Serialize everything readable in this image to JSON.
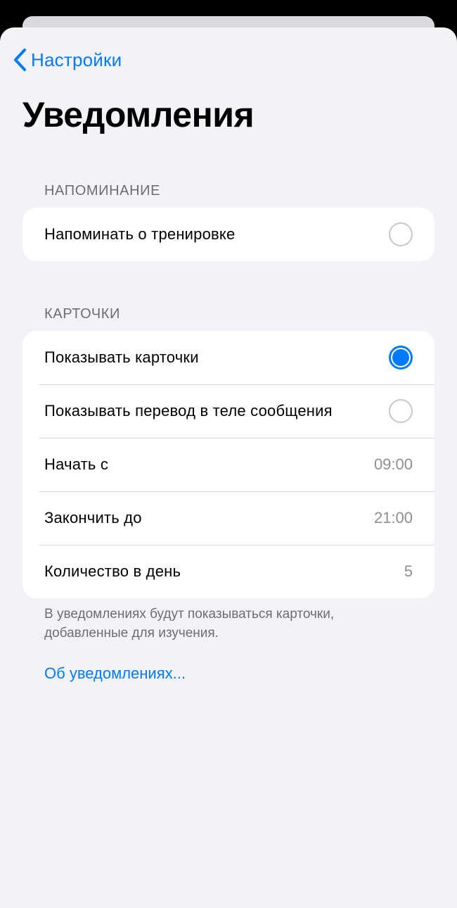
{
  "nav": {
    "back_label": "Настройки",
    "title": "Уведомления"
  },
  "sections": {
    "reminder": {
      "header": "НАПОМИНАНИЕ",
      "rows": [
        {
          "label": "Напоминать о тренировке",
          "control": "radio",
          "checked": false
        }
      ]
    },
    "cards": {
      "header": "КАРТОЧКИ",
      "rows": [
        {
          "label": "Показывать карточки",
          "control": "radio",
          "checked": true
        },
        {
          "label": "Показывать перевод в теле сообщения",
          "control": "radio",
          "checked": false
        },
        {
          "label": "Начать с",
          "value": "09:00"
        },
        {
          "label": "Закончить до",
          "value": "21:00"
        },
        {
          "label": "Количество в день",
          "value": "5"
        }
      ],
      "footer": "В уведомлениях будут показываться карточки, добавленные для изучения."
    }
  },
  "link": {
    "label": "Об уведомлениях..."
  },
  "colors": {
    "accent": "#007aff",
    "background": "#f2f2f7",
    "secondary_text": "#8e8e93"
  },
  "icons": {
    "back": "chevron-left-icon"
  }
}
